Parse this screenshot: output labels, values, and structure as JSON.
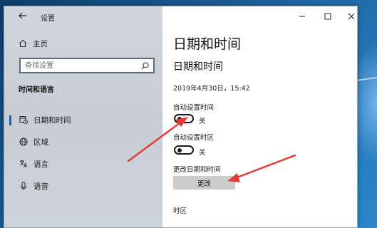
{
  "window": {
    "app_title": "设置",
    "controls": [
      "minimize-icon",
      "maximize-icon",
      "close-icon"
    ]
  },
  "sidebar": {
    "home_label": "主页",
    "search_placeholder": "查找设置",
    "section_heading": "时间和语言",
    "items": [
      {
        "label": "日期和时间",
        "icon": "calendar-clock-icon",
        "active": true
      },
      {
        "label": "区域",
        "icon": "globe-icon",
        "active": false
      },
      {
        "label": "语言",
        "icon": "language-icon",
        "active": false
      },
      {
        "label": "语音",
        "icon": "microphone-icon",
        "active": false
      }
    ]
  },
  "main": {
    "page_title": "日期和时间",
    "section_title": "日期和时间",
    "current_datetime": "2019年4月30日，15:42",
    "auto_time": {
      "label": "自动设置时间",
      "state": "关",
      "on": false
    },
    "auto_timezone": {
      "label": "自动设置时区",
      "state": "关",
      "on": false
    },
    "change_datetime": {
      "label": "更改日期和时间",
      "button": "更改"
    },
    "timezone_label": "时区"
  },
  "colors": {
    "accent": "#0067c0",
    "annotation_arrow": "#e53935",
    "sidebar_bg": "#c9d0d8"
  }
}
